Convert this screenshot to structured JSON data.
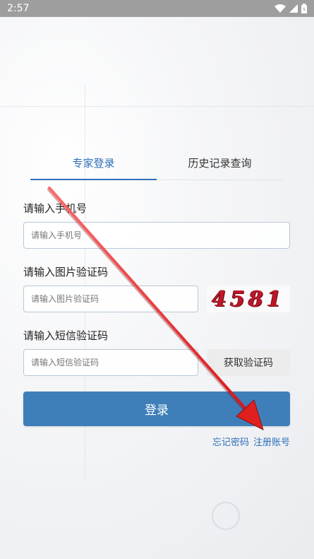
{
  "status_bar": {
    "time": "2:57",
    "icons": [
      "wifi-icon",
      "signal-icon",
      "battery-icon"
    ]
  },
  "tabs": [
    {
      "label": "专家登录",
      "active": true
    },
    {
      "label": "历史记录查询",
      "active": false
    }
  ],
  "phone": {
    "label": "请输入手机号",
    "placeholder": "请输入手机号",
    "value": ""
  },
  "image_code": {
    "label": "请输入图片验证码",
    "placeholder": "请输入图片验证码",
    "value": "",
    "captcha_text": "4581"
  },
  "sms_code": {
    "label": "请输入短信验证码",
    "placeholder": "请输入短信验证码",
    "value": "",
    "button_label": "获取验证码"
  },
  "login_button": "登录",
  "links": {
    "forgot_password": "忘记密码",
    "register": "注册账号"
  },
  "colors": {
    "accent": "#2f6fb8",
    "login_button": "#3e7fba",
    "arrow": "#e0201e"
  }
}
